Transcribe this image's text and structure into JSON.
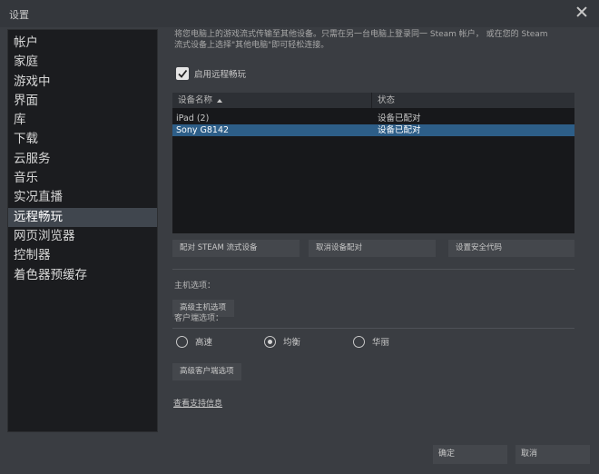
{
  "window": {
    "title": "设置"
  },
  "sidebar": {
    "items": [
      {
        "label": "帐户",
        "active": false
      },
      {
        "label": "家庭",
        "active": false
      },
      {
        "label": "游戏中",
        "active": false
      },
      {
        "label": "界面",
        "active": false
      },
      {
        "label": "库",
        "active": false
      },
      {
        "label": "下载",
        "active": false
      },
      {
        "label": "云服务",
        "active": false
      },
      {
        "label": "音乐",
        "active": false
      },
      {
        "label": "实况直播",
        "active": false
      },
      {
        "label": "远程畅玩",
        "active": true
      },
      {
        "label": "网页浏览器",
        "active": false
      },
      {
        "label": "控制器",
        "active": false
      },
      {
        "label": "着色器预缓存",
        "active": false
      }
    ]
  },
  "main": {
    "description_line1": "将您电脑上的游戏流式传输至其他设备。只需在另一台电脑上登录同一 Steam 帐户， 或在您的 Steam",
    "description_line2": "流式设备上选择\"其他电脑\"即可轻松连接。",
    "enable_checkbox": {
      "label": "启用远程畅玩",
      "checked": true
    },
    "device_table": {
      "headers": {
        "name": "设备名称",
        "status": "状态"
      },
      "rows": [
        {
          "name": "iPad (2)",
          "status": "设备已配对",
          "selected": false
        },
        {
          "name": "Sony G8142",
          "status": "设备已配对",
          "selected": true
        }
      ]
    },
    "buttons": {
      "pair": "配对 STEAM 流式设备",
      "unpair": "取消设备配对",
      "security_code": "设置安全代码"
    },
    "host_options": {
      "label": "主机选项：",
      "advanced_button": "高级主机选项"
    },
    "client_options": {
      "label": "客户端选项：",
      "radios": [
        {
          "label": "高速",
          "selected": false
        },
        {
          "label": "均衡",
          "selected": true
        },
        {
          "label": "华丽",
          "selected": false
        }
      ],
      "advanced_button": "高级客户端选项"
    },
    "support_link": "查看支持信息"
  },
  "footer": {
    "ok": "确定",
    "cancel": "取消"
  },
  "colors": {
    "background": "#3a3d42",
    "sidebar_bg": "#1b1c1f",
    "selected_row": "#2d5e88",
    "button_bg": "#44474c"
  }
}
